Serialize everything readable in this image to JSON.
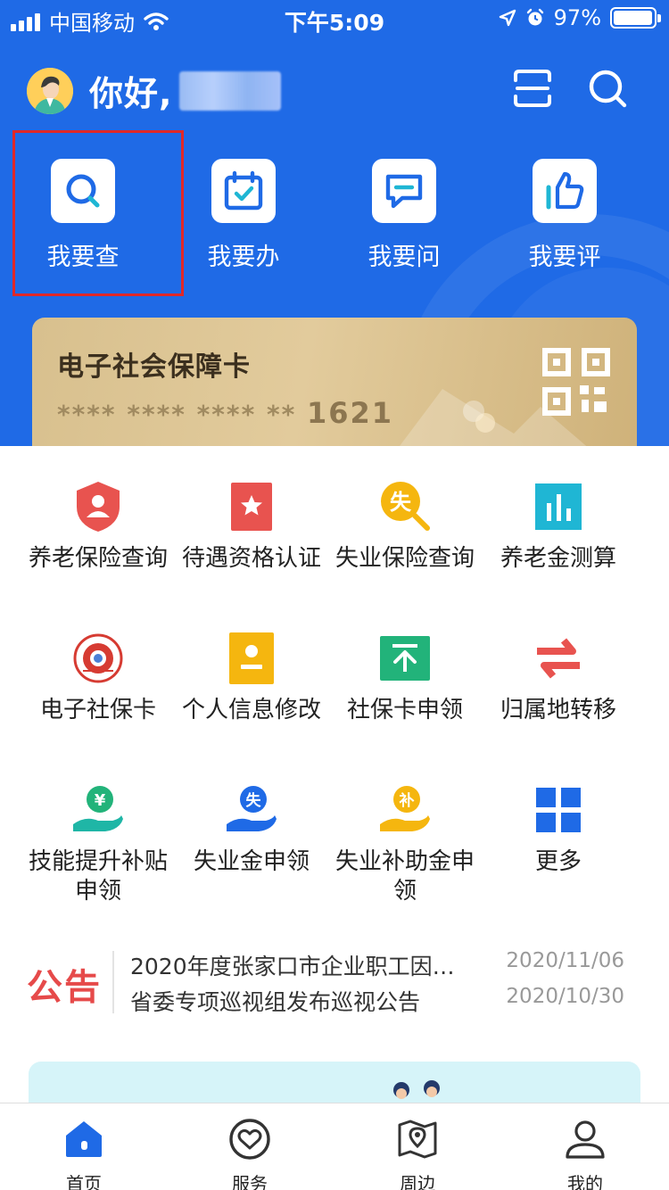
{
  "status_bar": {
    "carrier": "中国移动",
    "time": "下午5:09",
    "battery": "97%",
    "battery_level": 0.97
  },
  "header": {
    "greeting": "你好,",
    "scan_icon": "scan-icon",
    "search_icon": "search-icon"
  },
  "quick_actions": [
    {
      "label": "我要查",
      "icon": "search-icon"
    },
    {
      "label": "我要办",
      "icon": "calendar-check-icon"
    },
    {
      "label": "我要问",
      "icon": "chat-icon"
    },
    {
      "label": "我要评",
      "icon": "thumbs-up-icon"
    }
  ],
  "card": {
    "title": "电子社会保障卡",
    "masked_number": "**** **** **** **",
    "number_tail": "1621"
  },
  "services": [
    {
      "label": "养老保险查询",
      "icon": "shield-user-icon",
      "color": "#e8534f"
    },
    {
      "label": "待遇资格认证",
      "icon": "star-badge-icon",
      "color": "#e8534f"
    },
    {
      "label": "失业保险查询",
      "icon": "search-badge-icon",
      "badge": "失",
      "color": "#f5b60f"
    },
    {
      "label": "养老金测算",
      "icon": "bar-chart-icon",
      "color": "#1fb6d4"
    },
    {
      "label": "电子社保卡",
      "icon": "social-security-card-icon",
      "color": "#d63b32"
    },
    {
      "label": "个人信息修改",
      "icon": "id-card-icon",
      "color": "#f5b60f"
    },
    {
      "label": "社保卡申领",
      "icon": "upload-icon",
      "color": "#22b37a"
    },
    {
      "label": "归属地转移",
      "icon": "transfer-arrows-icon",
      "color": "#e8534f"
    },
    {
      "label": "技能提升补贴申领",
      "icon": "yuan-hand-icon",
      "badge": "¥",
      "color": "#22b37a"
    },
    {
      "label": "失业金申领",
      "icon": "hand-badge-icon",
      "badge": "失",
      "color": "#1f6ae6"
    },
    {
      "label": "失业补助金申领",
      "icon": "hand-badge-icon",
      "badge": "补",
      "color": "#f5b60f"
    },
    {
      "label": "更多",
      "icon": "grid-icon",
      "color": "#1f6ae6"
    }
  ],
  "notice": {
    "logo": "公告",
    "items": [
      {
        "title": "2020年度张家口市企业职工因…",
        "date": "2020/11/06"
      },
      {
        "title": "省委专项巡视组发布巡视公告",
        "date": "2020/10/30"
      }
    ]
  },
  "tabs": [
    {
      "label": "首页",
      "icon": "home-icon",
      "active": true
    },
    {
      "label": "服务",
      "icon": "heart-circle-icon",
      "active": false
    },
    {
      "label": "周边",
      "icon": "map-pin-icon",
      "active": false
    },
    {
      "label": "我的",
      "icon": "user-icon",
      "active": false
    }
  ]
}
